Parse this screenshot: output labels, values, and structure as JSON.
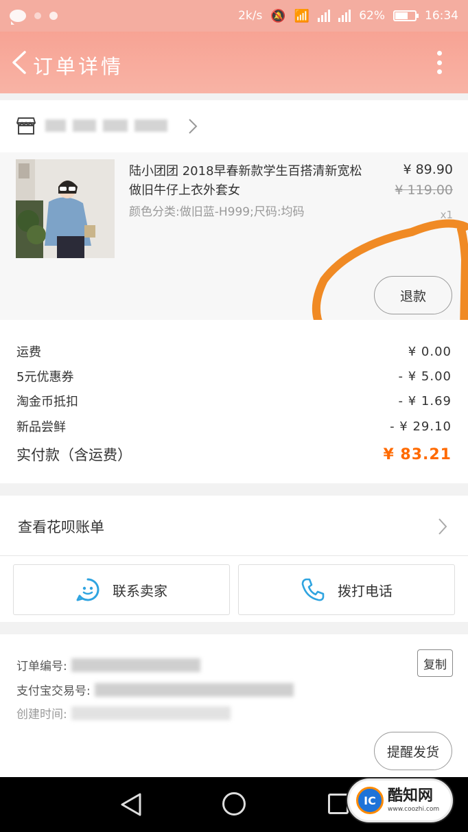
{
  "status_bar": {
    "speed": "2k/s",
    "net_4g": "4G",
    "net_2g": "2G",
    "battery": "62%",
    "time": "16:34"
  },
  "header": {
    "title": "订单详情"
  },
  "product": {
    "title": "陆小团团 2018早春新款学生百搭清新宽松做旧牛仔上衣外套女",
    "spec": "颜色分类:做旧蓝-H999;尺码:均码",
    "price": "¥ 89.90",
    "original_price": "¥ 119.00",
    "quantity": "x1",
    "refund_label": "退款"
  },
  "fees": {
    "rows": [
      {
        "label": "运费",
        "amount": "¥ 0.00"
      },
      {
        "label": "5元优惠券",
        "amount": "- ¥ 5.00"
      },
      {
        "label": "淘金币抵扣",
        "amount": "- ¥ 1.69"
      },
      {
        "label": "新品尝鲜",
        "amount": "- ¥ 29.10"
      }
    ],
    "total_label": "实付款（含运费）",
    "total_amount": "¥ 83.21",
    "total_color": "#ff6a00"
  },
  "huabei": {
    "label": "查看花呗账单"
  },
  "actions": {
    "contact_label": "联系卖家",
    "call_label": "拨打电话",
    "accent": "#2fa4e0"
  },
  "order_info": {
    "order_no_label": "订单编号:",
    "alipay_label": "支付宝交易号:",
    "created_label": "创建时间:",
    "copy_label": "复制",
    "remind_label": "提醒发货"
  },
  "watermark": {
    "logo_text": "IC",
    "title": "酷知网",
    "url": "www.coozhi.com"
  },
  "theme": {
    "header_color": "#f7a394",
    "annotation_color": "#f08a24"
  }
}
